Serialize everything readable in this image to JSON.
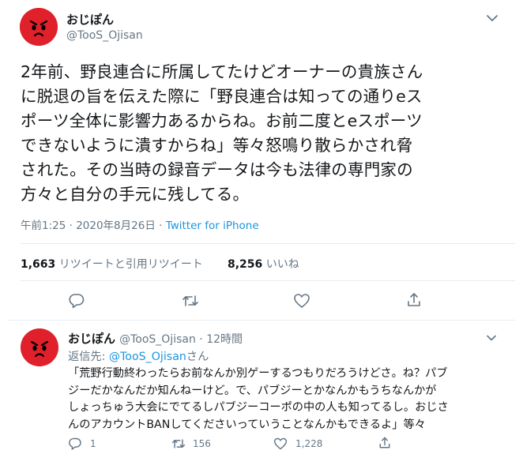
{
  "main_tweet": {
    "display_name": "おじぽん",
    "handle": "@TooS_Ojisan",
    "text_lines": [
      "2年前、野良連合に所属してたけどオーナーの貴族さん",
      "に脱退の旨を伝えた際に「野良連合は知っての通りeス",
      "ポーツ全体に影響力あるからね。お前二度とeスポーツ",
      "できないように潰すからね」等々怒鳴り散らかされ脅",
      "された。その当時の録音データは今も法律の専門家の",
      "方々と自分の手元に残してる。"
    ],
    "timestamp": "午前1:25 · 2020年8月26日 · ",
    "source": "Twitter for iPhone",
    "retweet_count": "1,663",
    "retweet_label": "リツイートと引用リツイート",
    "like_count": "8,256",
    "like_label": "いいね"
  },
  "reply_tweet": {
    "display_name": "おじぽん",
    "handle_time": "@TooS_Ojisan · 12時間",
    "reply_to_prefix": "返信先: ",
    "reply_to_handle": "@TooS_Ojisan",
    "reply_to_suffix": "さん",
    "text_lines": [
      "「荒野行動終わったらお前なんか別ゲーするつもりだろうけどさ。ね？パブ",
      "ジーだかなんだか知んねーけど。で、パブジーとかなんかもうちなんかが",
      "しょっちゅう大会にでてるしパブジーコーポの中の人も知ってるし。おじさ",
      "んのアカウントBANしてくださいっていうことなんかもできるよ」等々"
    ],
    "reply_count": "1",
    "retweet_count": "156",
    "like_count": "1,228"
  },
  "colors": {
    "avatar": "#e0202a",
    "link": "#1b95e0",
    "secondary_text": "#657786"
  }
}
